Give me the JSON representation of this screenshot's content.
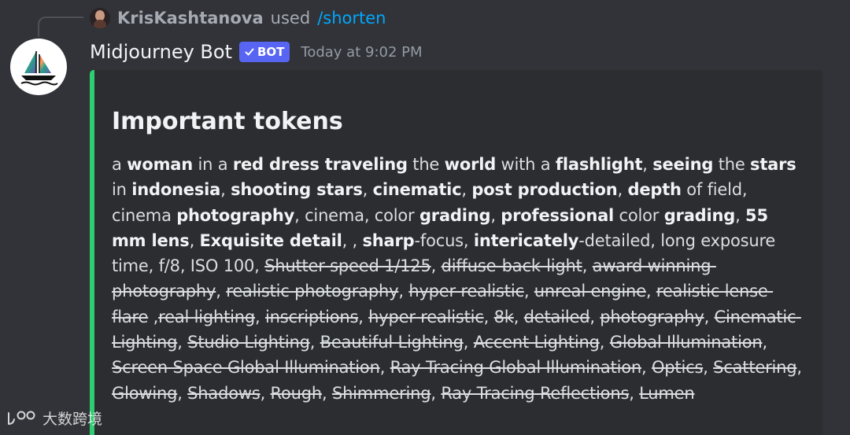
{
  "reply": {
    "username": "KrisKashtanova",
    "verb": "used",
    "command": "/shorten"
  },
  "message": {
    "author": "Midjourney Bot",
    "bot_tag": "BOT",
    "timestamp": "Today at 9:02 PM"
  },
  "embed": {
    "accent_color": "#2fcc71",
    "title": "Important tokens",
    "segments": [
      {
        "text": "a ",
        "style": "n"
      },
      {
        "text": "woman",
        "style": "b"
      },
      {
        "text": " in a ",
        "style": "n"
      },
      {
        "text": "red dress traveling",
        "style": "b"
      },
      {
        "text": " the ",
        "style": "n"
      },
      {
        "text": "world",
        "style": "b"
      },
      {
        "text": " with a ",
        "style": "n"
      },
      {
        "text": "flashlight",
        "style": "b"
      },
      {
        "text": ", ",
        "style": "n"
      },
      {
        "text": "seeing",
        "style": "b"
      },
      {
        "text": " the ",
        "style": "n"
      },
      {
        "text": "stars",
        "style": "b"
      },
      {
        "text": " in ",
        "style": "n"
      },
      {
        "text": "indonesia",
        "style": "b"
      },
      {
        "text": ", ",
        "style": "n"
      },
      {
        "text": "shooting stars",
        "style": "b"
      },
      {
        "text": ", ",
        "style": "n"
      },
      {
        "text": "cinematic",
        "style": "b"
      },
      {
        "text": ", ",
        "style": "n"
      },
      {
        "text": "post production",
        "style": "b"
      },
      {
        "text": ", ",
        "style": "n"
      },
      {
        "text": "depth",
        "style": "b"
      },
      {
        "text": " of field, cinema ",
        "style": "n"
      },
      {
        "text": "photography",
        "style": "b"
      },
      {
        "text": ", cinema, color ",
        "style": "n"
      },
      {
        "text": "grading",
        "style": "b"
      },
      {
        "text": ", ",
        "style": "n"
      },
      {
        "text": "professional",
        "style": "b"
      },
      {
        "text": " color ",
        "style": "n"
      },
      {
        "text": "grading",
        "style": "b"
      },
      {
        "text": ", ",
        "style": "n"
      },
      {
        "text": "55 mm lens",
        "style": "b"
      },
      {
        "text": ", ",
        "style": "n"
      },
      {
        "text": "Exquisite detail",
        "style": "b"
      },
      {
        "text": ", , ",
        "style": "n"
      },
      {
        "text": "sharp",
        "style": "b"
      },
      {
        "text": "-focus, ",
        "style": "n"
      },
      {
        "text": "intericately",
        "style": "b"
      },
      {
        "text": "-detailed, long exposure time, f/8, ISO 100, ",
        "style": "n"
      },
      {
        "text": "Shutter speed 1/125",
        "style": "s"
      },
      {
        "text": ", ",
        "style": "n"
      },
      {
        "text": "diffuse-back-light",
        "style": "s"
      },
      {
        "text": ", ",
        "style": "n"
      },
      {
        "text": "award winning photography",
        "style": "s"
      },
      {
        "text": ", ",
        "style": "n"
      },
      {
        "text": "realistic photography",
        "style": "s"
      },
      {
        "text": ", ",
        "style": "n"
      },
      {
        "text": "hyper realistic",
        "style": "s"
      },
      {
        "text": ", ",
        "style": "n"
      },
      {
        "text": "unreal engine",
        "style": "s"
      },
      {
        "text": ", ",
        "style": "n"
      },
      {
        "text": "realistic lense flare",
        "style": "s"
      },
      {
        "text": " ,",
        "style": "n"
      },
      {
        "text": "real lighting",
        "style": "s"
      },
      {
        "text": ", ",
        "style": "n"
      },
      {
        "text": "inscriptions",
        "style": "s"
      },
      {
        "text": ", ",
        "style": "n"
      },
      {
        "text": "hyper realistic",
        "style": "s"
      },
      {
        "text": ", ",
        "style": "n"
      },
      {
        "text": "8k",
        "style": "s"
      },
      {
        "text": ", ",
        "style": "n"
      },
      {
        "text": "detailed",
        "style": "s"
      },
      {
        "text": ", ",
        "style": "n"
      },
      {
        "text": "photography",
        "style": "s"
      },
      {
        "text": ", ",
        "style": "n"
      },
      {
        "text": "Cinematic Lighting",
        "style": "s"
      },
      {
        "text": ", ",
        "style": "n"
      },
      {
        "text": "Studio Lighting",
        "style": "s"
      },
      {
        "text": ", ",
        "style": "n"
      },
      {
        "text": "Beautiful Lighting",
        "style": "s"
      },
      {
        "text": ", ",
        "style": "n"
      },
      {
        "text": "Accent Lighting",
        "style": "s"
      },
      {
        "text": ", ",
        "style": "n"
      },
      {
        "text": "Global Illumination",
        "style": "s"
      },
      {
        "text": ", ",
        "style": "n"
      },
      {
        "text": "Screen Space Global Illumination",
        "style": "s"
      },
      {
        "text": ", ",
        "style": "n"
      },
      {
        "text": "Ray Tracing Global Illumination",
        "style": "s"
      },
      {
        "text": ", ",
        "style": "n"
      },
      {
        "text": "Optics",
        "style": "s"
      },
      {
        "text": ", ",
        "style": "n"
      },
      {
        "text": "Scattering",
        "style": "s"
      },
      {
        "text": ", ",
        "style": "n"
      },
      {
        "text": "Glowing",
        "style": "s"
      },
      {
        "text": ", ",
        "style": "n"
      },
      {
        "text": "Shadows",
        "style": "s"
      },
      {
        "text": ", ",
        "style": "n"
      },
      {
        "text": "Rough",
        "style": "s"
      },
      {
        "text": ", ",
        "style": "n"
      },
      {
        "text": "Shimmering",
        "style": "s"
      },
      {
        "text": ", ",
        "style": "n"
      },
      {
        "text": "Ray Tracing Reflections",
        "style": "s"
      },
      {
        "text": ", ",
        "style": "n"
      },
      {
        "text": "Lumen",
        "style": "s"
      }
    ]
  },
  "watermark": {
    "text": "大数跨境"
  },
  "icons": {
    "bot_avatar": "midjourney-sailboat-icon",
    "bot_tag_check": "checkmark-icon",
    "watermark_logo": "watermark-logo-icon"
  }
}
